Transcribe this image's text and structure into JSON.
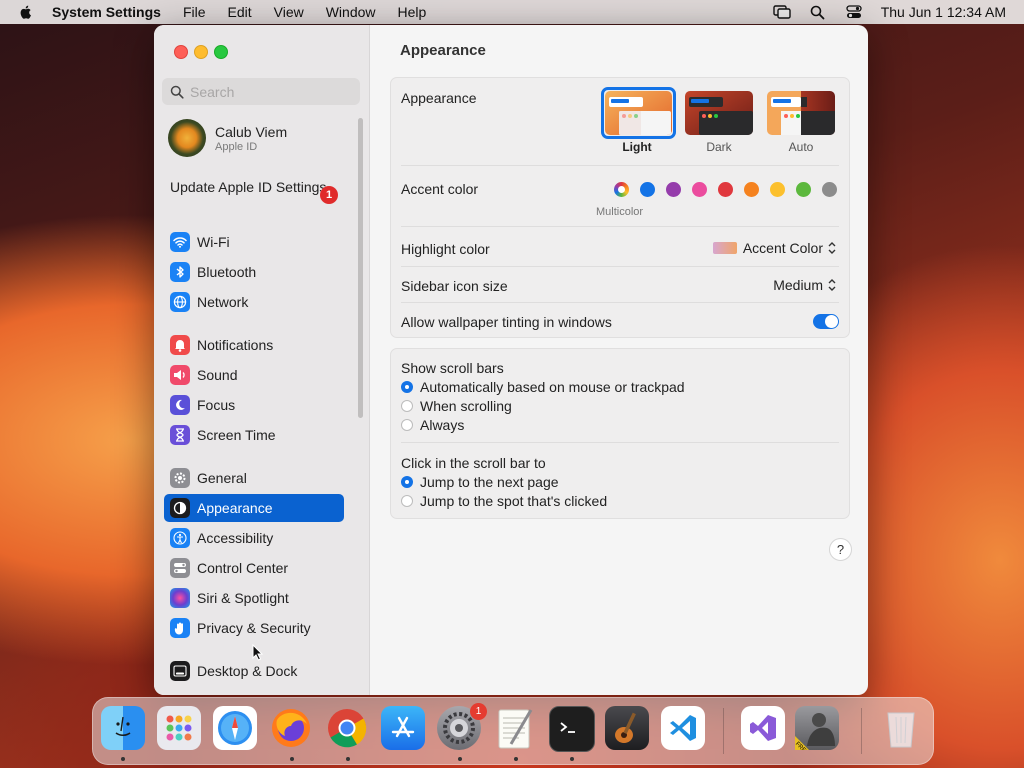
{
  "menubar": {
    "app_name": "System Settings",
    "items": [
      "File",
      "Edit",
      "View",
      "Window",
      "Help"
    ],
    "clock": "Thu Jun 1  12:34 AM",
    "icons": [
      "apple-icon",
      "screen-mirroring-icon",
      "spotlight-search-icon",
      "control-center-icon"
    ]
  },
  "sidebar": {
    "search_placeholder": "Search",
    "profile": {
      "name": "Calub Viem",
      "subtitle": "Apple ID"
    },
    "update": {
      "label": "Update Apple ID Settings",
      "badge": "1"
    },
    "items": [
      {
        "label": "Wi-Fi",
        "icon": "wifi-icon",
        "color": "#1a82f5"
      },
      {
        "label": "Bluetooth",
        "icon": "bluetooth-icon",
        "color": "#1a82f5"
      },
      {
        "label": "Network",
        "icon": "globe-icon",
        "color": "#1a82f5"
      },
      {
        "label": "Notifications",
        "icon": "bell-icon",
        "color": "#f04a4a"
      },
      {
        "label": "Sound",
        "icon": "speaker-icon",
        "color": "#f04a6a"
      },
      {
        "label": "Focus",
        "icon": "moon-icon",
        "color": "#5a50d8"
      },
      {
        "label": "Screen Time",
        "icon": "hourglass-icon",
        "color": "#6a4fd8"
      },
      {
        "label": "General",
        "icon": "gear-icon",
        "color": "#8e8e93"
      },
      {
        "label": "Appearance",
        "icon": "appearance-icon",
        "color": "#1c1c1e"
      },
      {
        "label": "Accessibility",
        "icon": "accessibility-icon",
        "color": "#1a82f5"
      },
      {
        "label": "Control Center",
        "icon": "switches-icon",
        "color": "#8e8e93"
      },
      {
        "label": "Siri & Spotlight",
        "icon": "siri-icon",
        "color": "#6a3fd0"
      },
      {
        "label": "Privacy & Security",
        "icon": "hand-icon",
        "color": "#1a82f5"
      },
      {
        "label": "Desktop & Dock",
        "icon": "dock-icon",
        "color": "#1c1c1e"
      }
    ],
    "selected": "Appearance"
  },
  "main": {
    "title": "Appearance",
    "appearance": {
      "label": "Appearance",
      "options": [
        "Light",
        "Dark",
        "Auto"
      ],
      "selected": "Light"
    },
    "accent": {
      "label": "Accent color",
      "colors": [
        "#8e5bd9",
        "#1473e6",
        "#953cab",
        "#eb4c9e",
        "#e0383e",
        "#f5821f",
        "#fcc02d",
        "#5cb83d",
        "#8c8c8c"
      ],
      "multicolor_label": "Multicolor"
    },
    "highlight": {
      "label": "Highlight color",
      "value": "Accent Color"
    },
    "sidebar_icon_size": {
      "label": "Sidebar icon size",
      "value": "Medium"
    },
    "wallpaper_tinting": {
      "label": "Allow wallpaper tinting in windows",
      "enabled": true
    },
    "scroll_bars": {
      "label": "Show scroll bars",
      "options": [
        "Automatically based on mouse or trackpad",
        "When scrolling",
        "Always"
      ],
      "selected": 0
    },
    "click_scroll": {
      "label": "Click in the scroll bar to",
      "options": [
        "Jump to the next page",
        "Jump to the spot that's clicked"
      ],
      "selected": 0
    },
    "help": "?"
  },
  "dock": {
    "apps": [
      "Finder",
      "Launchpad",
      "Safari",
      "Firefox",
      "Chrome",
      "App Store",
      "System Settings",
      "TextEdit",
      "Terminal",
      "GarageBand",
      "VS Code",
      "Visual Studio",
      "Unity Free",
      "Trash"
    ],
    "settings_badge": "1"
  }
}
